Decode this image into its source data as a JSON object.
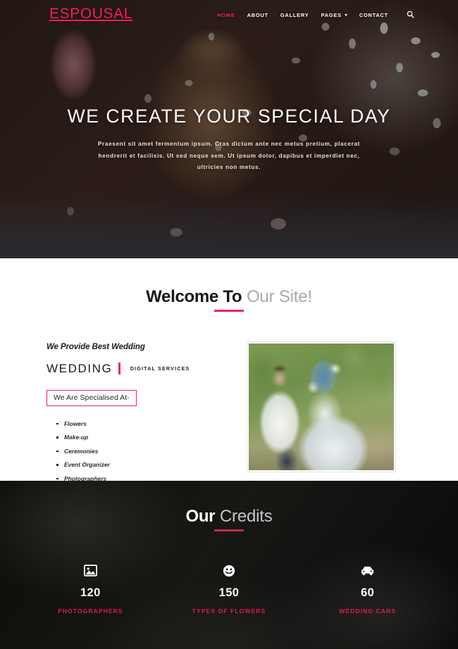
{
  "nav": {
    "logo": "ESPOUSAL",
    "items": [
      {
        "label": "HOME",
        "active": true,
        "dropdown": false
      },
      {
        "label": "ABOUT",
        "active": false,
        "dropdown": false
      },
      {
        "label": "GALLERY",
        "active": false,
        "dropdown": false
      },
      {
        "label": "PAGES",
        "active": false,
        "dropdown": true
      },
      {
        "label": "CONTACT",
        "active": false,
        "dropdown": false
      }
    ],
    "search_icon": "search-icon"
  },
  "hero": {
    "title": "WE CREATE YOUR SPECIAL DAY",
    "subtitle": "Praesent sit amet fermentum ipsum. Cras dictum ante nec metus pretium, placerat hendrerit et facilisis. Ut sed neque sem. Ut ipsum dolor, dapibus et imperdiet nec, ultricies non metus."
  },
  "welcome": {
    "heading_bold": "Welcome To",
    "heading_light": "Our Site!",
    "kicker": "We Provide Best Wedding",
    "brand_word": "WEDDING",
    "brand_tag": "DIGITAL SERVICES",
    "specialised_label": "We Are Specialised At-",
    "specialities": [
      "Flowers",
      "Make-up",
      "Ceremonies",
      "Event Organizer",
      "Photographers"
    ]
  },
  "credits": {
    "heading_bold": "Our",
    "heading_light": "Credits",
    "counters": [
      {
        "icon": "image-icon",
        "value": "120",
        "label": "PHOTOGRAPHERS"
      },
      {
        "icon": "smiley-icon",
        "value": "150",
        "label": "TYPES OF FLOWERS"
      },
      {
        "icon": "car-icon",
        "value": "60",
        "label": "WEDDING CARS"
      }
    ]
  },
  "colors": {
    "accent_pink": "#f2215c",
    "accent_red": "#e01b54",
    "dark": "#16161c",
    "muted": "#a9a9ad"
  }
}
